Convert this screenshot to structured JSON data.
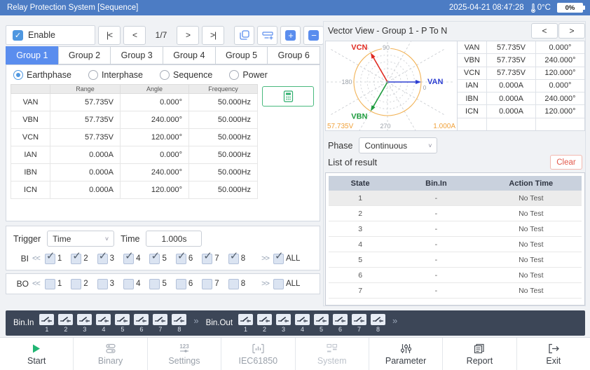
{
  "titlebar": {
    "title": "Relay Protection System [Sequence]",
    "datetime": "2025-04-21 08:47:28",
    "temperature": "0°C",
    "battery": "0%"
  },
  "left": {
    "enable_label": "Enable",
    "pager": {
      "first": "|<",
      "prev": "<",
      "page": "1/7",
      "next": ">",
      "last": ">|"
    },
    "tabs": {
      "items": [
        "Group 1",
        "Group 2",
        "Group 3",
        "Group 4",
        "Group 5",
        "Group 6"
      ],
      "active": 0
    },
    "modes": [
      {
        "label": "Earthphase",
        "selected": true
      },
      {
        "label": "Interphase",
        "selected": false
      },
      {
        "label": "Sequence",
        "selected": false
      },
      {
        "label": "Power",
        "selected": false
      }
    ],
    "channel_table": {
      "headers": [
        "",
        "Range",
        "Angle",
        "Frequency"
      ],
      "rows": [
        [
          "VAN",
          "57.735V",
          "0.000°",
          "50.000Hz"
        ],
        [
          "VBN",
          "57.735V",
          "240.000°",
          "50.000Hz"
        ],
        [
          "VCN",
          "57.735V",
          "120.000°",
          "50.000Hz"
        ],
        [
          "IAN",
          "0.000A",
          "0.000°",
          "50.000Hz"
        ],
        [
          "IBN",
          "0.000A",
          "240.000°",
          "50.000Hz"
        ],
        [
          "ICN",
          "0.000A",
          "120.000°",
          "50.000Hz"
        ]
      ]
    },
    "trigger": {
      "label": "Trigger",
      "type_value": "Time",
      "time_label": "Time",
      "time_value": "1.000s"
    },
    "bi": {
      "label": "BI",
      "in_arrows": "<<",
      "out_arrows": ">>",
      "channels": [
        "1",
        "2",
        "3",
        "4",
        "5",
        "6",
        "7",
        "8"
      ],
      "all_label": "ALL",
      "checked": true,
      "all_checked": true
    },
    "bo": {
      "label": "BO",
      "in_arrows": "<<",
      "out_arrows": ">>",
      "channels": [
        "1",
        "2",
        "3",
        "4",
        "5",
        "6",
        "7",
        "8"
      ],
      "all_label": "ALL",
      "checked": false,
      "all_checked": false
    }
  },
  "right": {
    "header": "Vector View - Group 1 - P To N",
    "pager": {
      "prev": "<",
      "next": ">"
    },
    "vector_table": [
      [
        "VAN",
        "57.735V",
        "0.000°"
      ],
      [
        "VBN",
        "57.735V",
        "240.000°"
      ],
      [
        "VCN",
        "57.735V",
        "120.000°"
      ],
      [
        "IAN",
        "0.000A",
        "0.000°"
      ],
      [
        "IBN",
        "0.000A",
        "240.000°"
      ],
      [
        "ICN",
        "0.000A",
        "120.000°"
      ]
    ],
    "polar": {
      "axis_labels": {
        "top": "90",
        "left": "180",
        "bottom": "270",
        "right": "0"
      },
      "voltage_scale": "57.735V",
      "current_scale": "1.000A",
      "circle_color": "#f2b357",
      "vectors": [
        {
          "name": "VAN",
          "angle": 0,
          "color": "#2c3ed2"
        },
        {
          "name": "VBN",
          "angle": 240,
          "color": "#1f9c3f"
        },
        {
          "name": "VCN",
          "angle": 120,
          "color": "#e02a21"
        }
      ]
    },
    "phase": {
      "label": "Phase",
      "value": "Continuous"
    },
    "result": {
      "title": "List of result",
      "clear_label": "Clear",
      "headers": [
        "State",
        "Bin.In",
        "Action Time"
      ],
      "rows": [
        [
          "1",
          "-",
          "No Test"
        ],
        [
          "2",
          "-",
          "No Test"
        ],
        [
          "3",
          "-",
          "No Test"
        ],
        [
          "4",
          "-",
          "No Test"
        ],
        [
          "5",
          "-",
          "No Test"
        ],
        [
          "6",
          "-",
          "No Test"
        ],
        [
          "7",
          "-",
          "No Test"
        ]
      ]
    }
  },
  "bin_bar": {
    "in_label": "Bin.In",
    "out_label": "Bin.Out",
    "separator": "»",
    "channels": [
      "1",
      "2",
      "3",
      "4",
      "5",
      "6",
      "7",
      "8"
    ]
  },
  "toolbar": {
    "items": [
      {
        "label": "Start"
      },
      {
        "label": "Binary"
      },
      {
        "label": "Settings"
      },
      {
        "label": "IEC61850"
      },
      {
        "label": "System"
      },
      {
        "label": "Parameter"
      },
      {
        "label": "Report"
      },
      {
        "label": "Exit"
      }
    ]
  },
  "colors": {
    "accent_blue": "#5a8dee",
    "title_blue": "#4c7cc4",
    "green": "#2fae6e",
    "clear_red": "#e2584a"
  }
}
